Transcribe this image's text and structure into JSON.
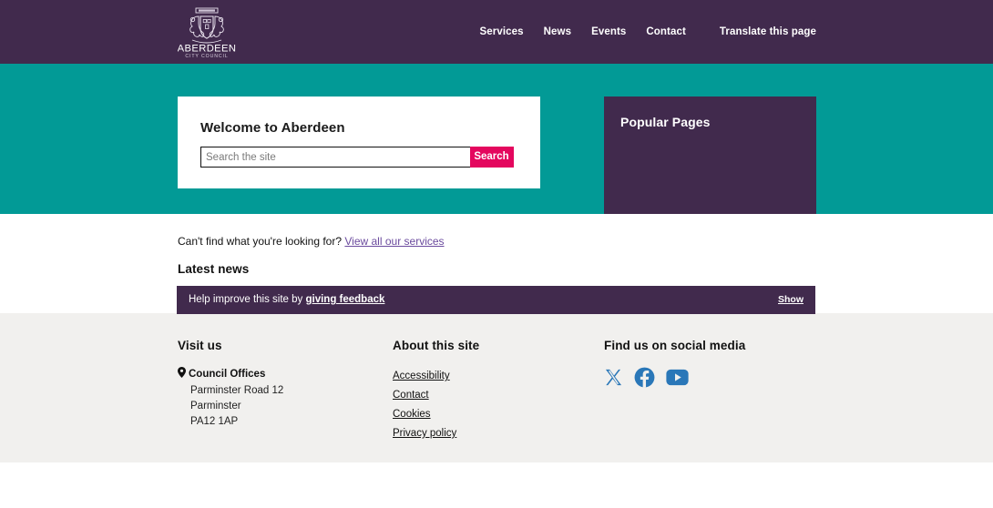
{
  "header": {
    "logo": {
      "name": "aberdeen-city-council-crest",
      "title": "ABERDEEN",
      "subtitle": "CITY COUNCIL"
    },
    "nav": [
      {
        "label": "Services"
      },
      {
        "label": "News"
      },
      {
        "label": "Events"
      },
      {
        "label": "Contact"
      },
      {
        "label": "Translate this page"
      }
    ]
  },
  "hero": {
    "search_card": {
      "heading": "Welcome to Aberdeen",
      "input_placeholder": "Search the site",
      "input_value": "",
      "button_label": "Search"
    },
    "popular_card": {
      "heading": "Popular Pages"
    }
  },
  "main": {
    "cant_find_text": "Can't find what you're looking for?",
    "cant_find_link": "View all our services",
    "latest_news_heading": "Latest news"
  },
  "feedback": {
    "text_prefix": "Help improve this site by",
    "link_label": "giving feedback",
    "show_label": "Show"
  },
  "footer": {
    "visit": {
      "heading": "Visit us",
      "org": "Council Offices",
      "line1": "Parminster Road 12",
      "line2": "Parminster",
      "line3": "PA12 1AP"
    },
    "about": {
      "heading": "About this site",
      "links": [
        {
          "label": "Accessibility"
        },
        {
          "label": "Contact"
        },
        {
          "label": "Cookies"
        },
        {
          "label": "Privacy policy"
        }
      ]
    },
    "social": {
      "heading": "Find us on social media",
      "icons": [
        {
          "name": "x-twitter-icon"
        },
        {
          "name": "facebook-icon"
        },
        {
          "name": "youtube-icon"
        }
      ]
    }
  },
  "colors": {
    "purple": "#412a4d",
    "teal": "#029a96",
    "pink": "#e4075e",
    "footer_grey": "#f1f0ee",
    "social_blue": "#2a77b8",
    "visited_link": "#6b4b9e"
  }
}
